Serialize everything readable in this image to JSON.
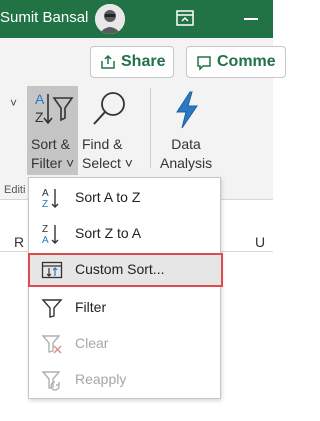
{
  "titlebar": {
    "user_name": "Sumit Bansal",
    "bg_color": "#217346"
  },
  "ribbon": {
    "share_label": "Share",
    "comments_label": "Comme",
    "sort_filter": {
      "line1": "Sort &",
      "line2": "Filter ˅"
    },
    "find_select": {
      "line1": "Find &",
      "line2": "Select ˅"
    },
    "data_analysis": {
      "line1": "Data",
      "line2": "Analysis"
    },
    "group_editing_partial": "Editi",
    "group_analysis_partial": "ysis"
  },
  "grid": {
    "col_left": "R",
    "col_right": "U"
  },
  "menu": {
    "items": [
      {
        "label": "Sort A to Z",
        "icon": "sort-a-to-z-icon",
        "enabled": true
      },
      {
        "label": "Sort Z to A",
        "icon": "sort-z-to-a-icon",
        "enabled": true
      },
      {
        "label": "Custom Sort...",
        "icon": "custom-sort-icon",
        "enabled": true,
        "highlighted": true
      },
      {
        "label": "Filter",
        "icon": "filter-icon",
        "enabled": true
      },
      {
        "label": "Clear",
        "icon": "clear-filter-icon",
        "enabled": false
      },
      {
        "label": "Reapply",
        "icon": "reapply-filter-icon",
        "enabled": false
      }
    ]
  },
  "colors": {
    "accent_green": "#217346",
    "highlight_border": "#e04a4a",
    "sort_blue": "#2b78c5"
  }
}
